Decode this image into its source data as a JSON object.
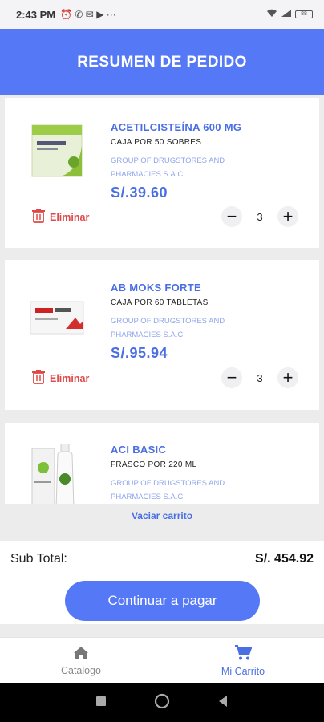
{
  "status_bar": {
    "time": "2:43 PM",
    "icons": "⏰ ✆ ✉ ▶ ···",
    "battery": "88"
  },
  "header": {
    "title": "RESUMEN DE PEDIDO"
  },
  "cart_items": [
    {
      "name": "ACETILCISTEÍNA 600 MG",
      "description": "CAJA POR 50 SOBRES",
      "vendor": "GROUP OF DRUGSTORES AND PHARMACIES S.A.C.",
      "price": "S/.39.60",
      "quantity": "3",
      "delete_label": "Eliminar",
      "image_text": "Acetilcisteína"
    },
    {
      "name": "AB MOKS FORTE",
      "description": "CAJA POR 60 TABLETAS",
      "vendor": "GROUP OF DRUGSTORES AND PHARMACIES S.A.C.",
      "price": "S/.95.94",
      "quantity": "3",
      "delete_label": "Eliminar",
      "image_text": "AB-MOKS Forte"
    },
    {
      "name": "ACI BASIC",
      "description": "FRASCO POR 220 ML",
      "vendor": "GROUP OF DRUGSTORES AND PHARMACIES S.A.C.",
      "price": "",
      "quantity": "",
      "delete_label": "",
      "image_text": ""
    }
  ],
  "clear_cart_label": "Vaciar carrito",
  "subtotal": {
    "label": "Sub Total:",
    "value": "S/. 454.92"
  },
  "pay_button_label": "Continuar a pagar",
  "bottom_nav": {
    "items": [
      {
        "label": "Catalogo",
        "icon": "home-icon",
        "active": false
      },
      {
        "label": "Mi Carrito",
        "icon": "cart-icon",
        "active": true
      }
    ]
  },
  "colors": {
    "primary": "#5578f6",
    "danger": "#e04848",
    "vendor": "#8fa6ec"
  }
}
